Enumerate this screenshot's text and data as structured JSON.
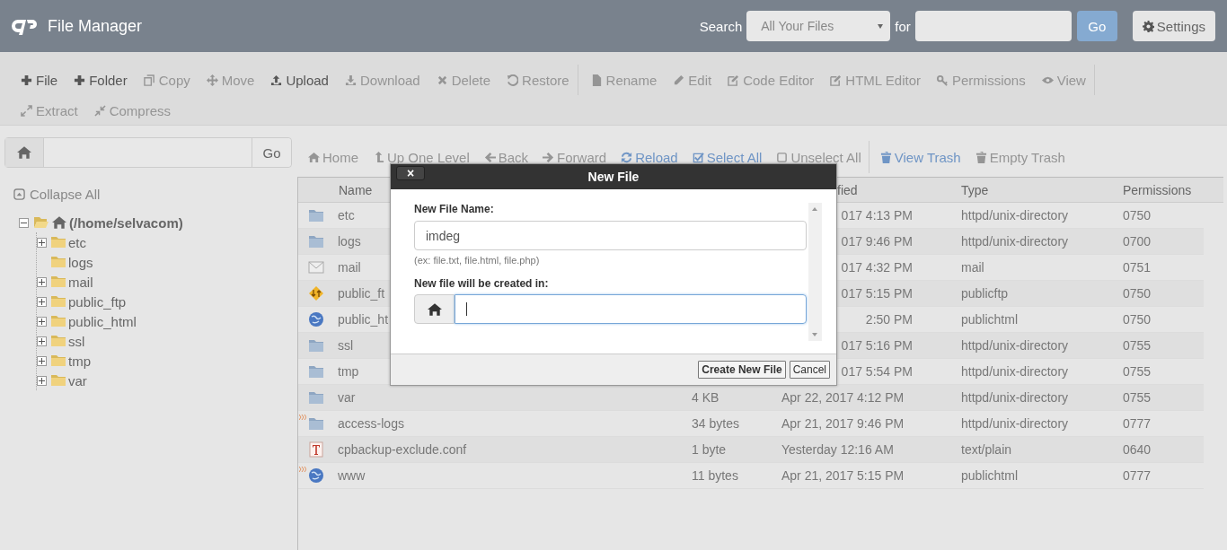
{
  "header": {
    "title": "File Manager",
    "search_label": "Search",
    "search_scope": "All Your Files",
    "for_label": "for",
    "go": "Go",
    "settings": "Settings"
  },
  "toolbar": {
    "groups": [
      [
        {
          "label": "File",
          "kind": "plus",
          "disabled": false
        },
        {
          "label": "Folder",
          "kind": "plus",
          "disabled": false
        },
        {
          "label": "Copy",
          "kind": "copy",
          "disabled": true
        },
        {
          "label": "Move",
          "kind": "move",
          "disabled": true
        },
        {
          "label": "Upload",
          "kind": "upload",
          "disabled": false
        },
        {
          "label": "Download",
          "kind": "download",
          "disabled": true
        },
        {
          "label": "Delete",
          "kind": "x",
          "disabled": true
        },
        {
          "label": "Restore",
          "kind": "undo",
          "disabled": true
        }
      ],
      [
        {
          "label": "Rename",
          "kind": "doc",
          "disabled": true
        },
        {
          "label": "Edit",
          "kind": "pencil",
          "disabled": true
        },
        {
          "label": "Code Editor",
          "kind": "editbox",
          "disabled": true
        },
        {
          "label": "HTML Editor",
          "kind": "editbox",
          "disabled": true
        },
        {
          "label": "Permissions",
          "kind": "key",
          "disabled": true
        },
        {
          "label": "View",
          "kind": "eye",
          "disabled": true
        }
      ],
      [
        {
          "label": "Extract",
          "kind": "expand",
          "disabled": true
        },
        {
          "label": "Compress",
          "kind": "compress",
          "disabled": true
        }
      ]
    ]
  },
  "path_bar": {
    "go": "Go"
  },
  "nav": {
    "groups": [
      [
        {
          "label": "Home",
          "kind": "home",
          "disabled": true
        },
        {
          "label": "Up One Level",
          "kind": "up",
          "disabled": true
        },
        {
          "label": "Back",
          "kind": "left",
          "disabled": true
        },
        {
          "label": "Forward",
          "kind": "right",
          "disabled": true
        },
        {
          "label": "Reload",
          "kind": "reload",
          "disabled": false
        },
        {
          "label": "Select All",
          "kind": "check",
          "disabled": false
        },
        {
          "label": "Unselect All",
          "kind": "square",
          "disabled": true
        }
      ],
      [
        {
          "label": "View Trash",
          "kind": "trash",
          "disabled": false
        },
        {
          "label": "Empty Trash",
          "kind": "trash",
          "disabled": true
        }
      ]
    ]
  },
  "tree": {
    "collapse_all": "Collapse All",
    "root": {
      "label": "(/home/selvacom)",
      "expanded": true,
      "children": [
        {
          "label": "etc",
          "expandable": true
        },
        {
          "label": "logs",
          "expandable": false
        },
        {
          "label": "mail",
          "expandable": true
        },
        {
          "label": "public_ftp",
          "expandable": true
        },
        {
          "label": "public_html",
          "expandable": true
        },
        {
          "label": "ssl",
          "expandable": true
        },
        {
          "label": "tmp",
          "expandable": true
        },
        {
          "label": "var",
          "expandable": true
        }
      ]
    }
  },
  "table": {
    "columns": [
      {
        "kind": "name",
        "label": "Name"
      },
      {
        "kind": "size"
      },
      {
        "kind": "modified",
        "label": "fied"
      },
      {
        "kind": "type",
        "label": "Type"
      },
      {
        "kind": "permissions",
        "label": "Permissions"
      }
    ],
    "rows": [
      {
        "kind": "folder",
        "name": "etc",
        "modified": "017 4:13 PM",
        "type": "httpd/unix-directory",
        "permissions": "0750",
        "covered": true,
        "symlink": false
      },
      {
        "kind": "folder",
        "name": "logs",
        "modified": "017 9:46 PM",
        "type": "httpd/unix-directory",
        "permissions": "0700",
        "covered": true,
        "symlink": false
      },
      {
        "kind": "mail",
        "name": "mail",
        "modified": "017 4:32 PM",
        "type": "mail",
        "permissions": "0751",
        "covered": true,
        "symlink": false
      },
      {
        "kind": "ftp",
        "name": "public_ft",
        "modified": "017 5:15 PM",
        "type": "publicftp",
        "permissions": "0750",
        "covered": true,
        "symlink": false
      },
      {
        "kind": "globe",
        "name": "public_ht",
        "modified": "2:50 PM",
        "type": "publichtml",
        "permissions": "0750",
        "covered": true,
        "symlink": false
      },
      {
        "kind": "folder",
        "name": "ssl",
        "modified": "017 5:16 PM",
        "type": "httpd/unix-directory",
        "permissions": "0755",
        "covered": true,
        "symlink": false
      },
      {
        "kind": "folder",
        "name": "tmp",
        "modified": "017 5:54 PM",
        "type": "httpd/unix-directory",
        "permissions": "0755",
        "covered": true,
        "symlink": false
      },
      {
        "kind": "folder",
        "name": "var",
        "size": "4 KB",
        "modified": "Apr 22, 2017 4:12 PM",
        "type": "httpd/unix-directory",
        "permissions": "0755",
        "covered": false,
        "symlink": false
      },
      {
        "kind": "folder",
        "name": "access-logs",
        "size": "34 bytes",
        "modified": "Apr 21, 2017 9:46 PM",
        "type": "httpd/unix-directory",
        "permissions": "0777",
        "covered": false,
        "symlink": true
      },
      {
        "kind": "text",
        "name": "cpbackup-exclude.conf",
        "size": "1 byte",
        "modified": "Yesterday 12:16 AM",
        "type": "text/plain",
        "permissions": "0640",
        "covered": false,
        "symlink": false
      },
      {
        "kind": "globe",
        "name": "www",
        "size": "11 bytes",
        "modified": "Apr 21, 2017 5:15 PM",
        "type": "publichtml",
        "permissions": "0777",
        "covered": false,
        "symlink": true
      }
    ]
  },
  "dialog": {
    "title": "New File",
    "close": "×",
    "name_label": "New File Name:",
    "name_value": "imdeg",
    "hint": "(ex: file.txt, file.html, file.php)",
    "dir_label": "New file will be created in:",
    "dir_focused": true,
    "buttons": [
      "Create New File",
      "Cancel"
    ]
  }
}
